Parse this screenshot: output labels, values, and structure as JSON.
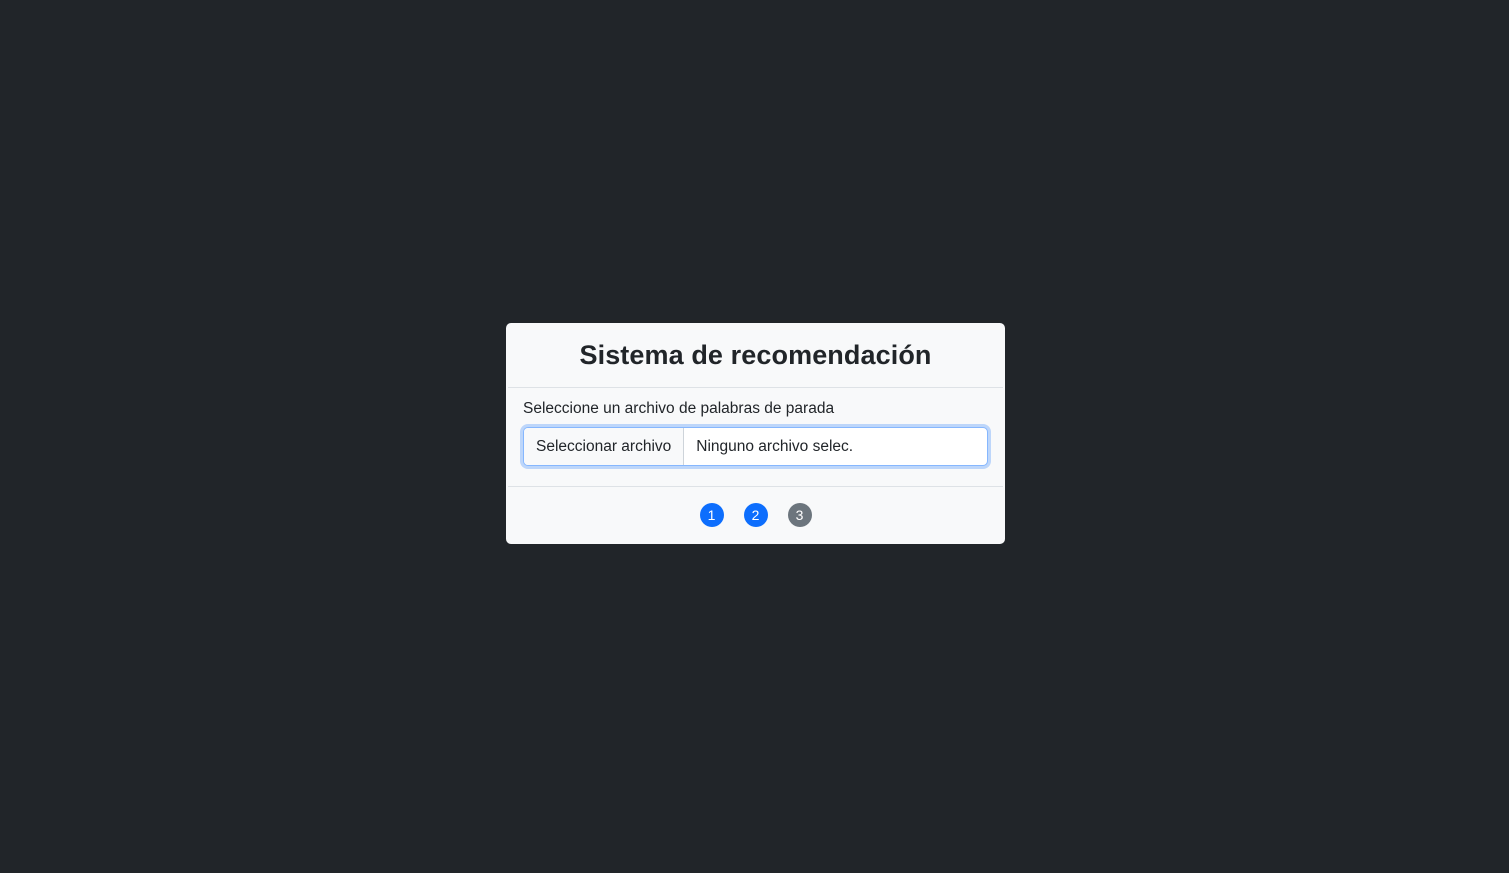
{
  "card": {
    "title": "Sistema de recomendación"
  },
  "form": {
    "label": "Seleccione un archivo de palabras de parada",
    "file_button_label": "Seleccionar archivo",
    "file_status": "Ninguno archivo selec."
  },
  "steps": [
    {
      "label": "1",
      "color": "#0d6efd"
    },
    {
      "label": "2",
      "color": "#0d6efd"
    },
    {
      "label": "3",
      "color": "#6c757d"
    }
  ],
  "colors": {
    "background": "#212529",
    "card": "#f8f9fa",
    "active_step": "#0d6efd",
    "inactive_step": "#6c757d"
  }
}
